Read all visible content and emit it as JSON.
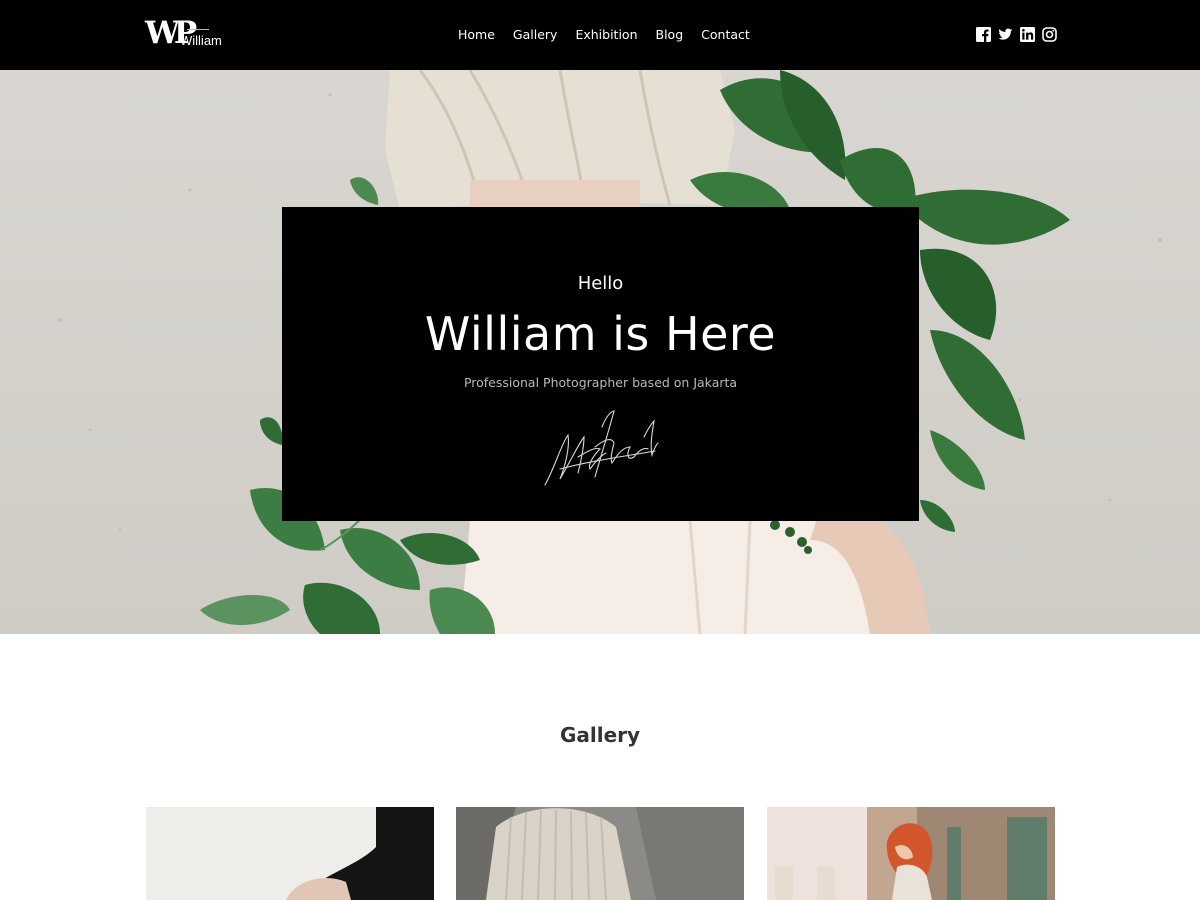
{
  "header": {
    "logo": {
      "mark": "WP",
      "word": "William"
    },
    "nav": [
      "Home",
      "Gallery",
      "Exhibition",
      "Blog",
      "Contact"
    ],
    "social_icons": [
      "facebook-icon",
      "twitter-icon",
      "linkedin-icon",
      "instagram-icon"
    ]
  },
  "hero": {
    "greeting": "Hello",
    "title": "William is Here",
    "subtitle": "Professional Photographer based on Jakarta"
  },
  "gallery": {
    "title": "Gallery"
  },
  "colors": {
    "header_bg": "#000000",
    "card_bg": "#000000",
    "page_bg": "#ffffff",
    "wall": "#d6d3ce",
    "leaf": "#2f6d35"
  }
}
